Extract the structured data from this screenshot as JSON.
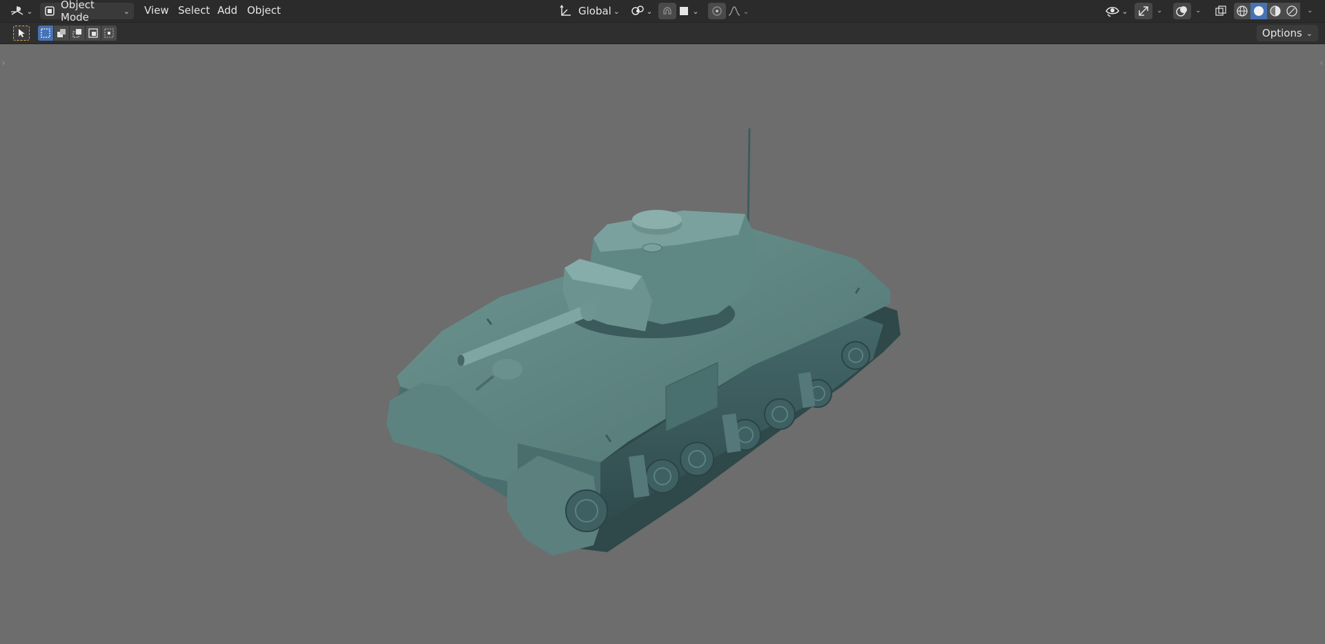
{
  "header": {
    "editor_type_icon": "editor-type-3d-viewport-icon",
    "mode": {
      "label": "Object Mode",
      "icon": "object-mode-icon"
    },
    "menus": [
      "View",
      "Select",
      "Add",
      "Object"
    ],
    "transform_orientation": {
      "label": "Global",
      "icon": "transform-orientation-icon"
    },
    "pivot_icon": "pivot-point-icon",
    "snap_icon": "snap-magnet-icon",
    "snap_target_icon": "snap-target-icon",
    "proportional_icon": "proportional-editing-icon",
    "falloff_icon": "falloff-curve-icon",
    "visibility_icon": "object-visibility-icon",
    "gizmo_icon": "gizmo-icon",
    "overlay_icon": "overlays-icon",
    "xray_icon": "xray-icon",
    "shading_modes": [
      "wireframe-shading-icon",
      "solid-shading-icon",
      "material-preview-icon",
      "rendered-shading-icon"
    ],
    "active_shading": "solid-shading-icon"
  },
  "tool_header": {
    "active_tool_icon": "select-box-tool-icon",
    "select_modes": [
      "select-new-icon",
      "select-extend-icon",
      "select-subtract-icon",
      "select-invert-icon",
      "select-intersect-icon"
    ],
    "options_label": "Options"
  },
  "colors": {
    "header_bg": "#2b2b2b",
    "viewport_bg": "#6d6d6d",
    "accent_blue": "#4772b3",
    "tool_active": "#e5a24a",
    "model_base": "#4f7471"
  },
  "viewport": {
    "model": "tank-model"
  }
}
